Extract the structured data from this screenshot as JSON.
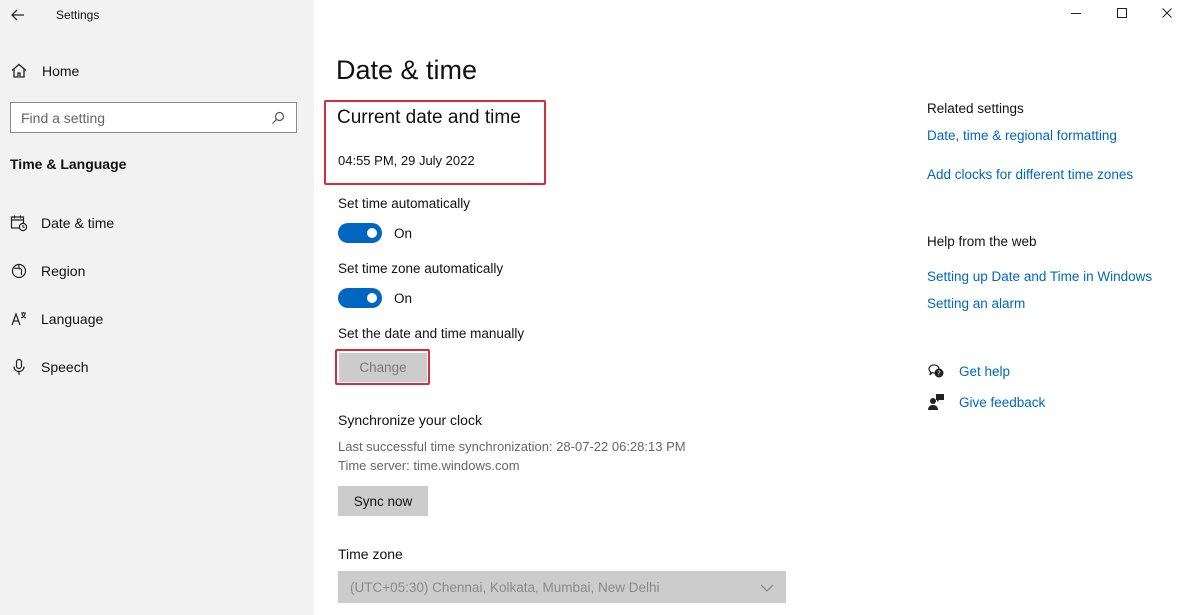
{
  "window": {
    "title": "Settings"
  },
  "sidebar": {
    "home_label": "Home",
    "search_placeholder": "Find a setting",
    "section": "Time & Language",
    "items": [
      {
        "label": "Date & time",
        "icon": "calendar-clock-icon"
      },
      {
        "label": "Region",
        "icon": "globe-icon"
      },
      {
        "label": "Language",
        "icon": "language-icon"
      },
      {
        "label": "Speech",
        "icon": "microphone-icon"
      }
    ]
  },
  "main": {
    "title": "Date & time",
    "current": {
      "heading": "Current date and time",
      "value": "04:55 PM, 29 July 2022"
    },
    "set_time_auto": {
      "label": "Set time automatically",
      "state": "On"
    },
    "set_tz_auto": {
      "label": "Set time zone automatically",
      "state": "On"
    },
    "manual": {
      "label": "Set the date and time manually",
      "button": "Change"
    },
    "sync": {
      "heading": "Synchronize your clock",
      "last_sync": "Last successful time synchronization: 28-07-22 06:28:13 PM",
      "server": "Time server: time.windows.com",
      "button": "Sync now"
    },
    "timezone": {
      "label": "Time zone",
      "value": "(UTC+05:30) Chennai, Kolkata, Mumbai, New Delhi"
    }
  },
  "right_panel": {
    "related_heading": "Related settings",
    "related_links": [
      "Date, time & regional formatting",
      "Add clocks for different time zones"
    ],
    "web_heading": "Help from the web",
    "web_links": [
      "Setting up Date and Time in Windows",
      "Setting an alarm"
    ],
    "get_help": "Get help",
    "give_feedback": "Give feedback"
  },
  "colors": {
    "accent": "#0067c0",
    "highlight": "#d32f3a",
    "sidebar_bg": "#f2f2f2"
  }
}
